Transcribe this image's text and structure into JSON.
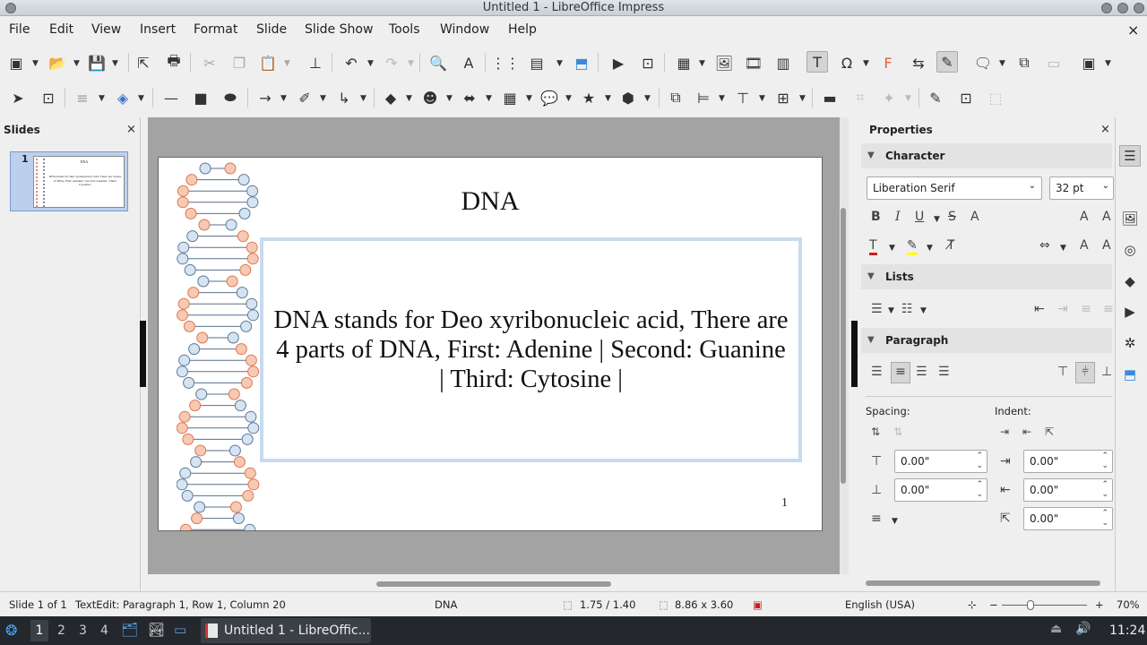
{
  "window": {
    "title": "Untitled 1 - LibreOffice Impress",
    "close_symbol": "×"
  },
  "menu": [
    "File",
    "Edit",
    "View",
    "Insert",
    "Format",
    "Slide",
    "Slide Show",
    "Tools",
    "Window",
    "Help"
  ],
  "slides_panel": {
    "title": "Slides",
    "close": "×",
    "thumb_number": "1"
  },
  "slide": {
    "title": "DNA",
    "body": "DNA stands for Deo xyribonucleic acid, There are 4 parts of DNA, First: Adenine | Second: Guanine | Third: Cytosine |",
    "number": "1",
    "thumb_title": "DNA",
    "thumb_body": "DNA stands for Deo xyribonucleic acid, There are 4 parts of DNA, First: Adenine | Second: Guanine | Third: Cytosine |"
  },
  "properties": {
    "title": "Properties",
    "close": "×",
    "character": {
      "label": "Character",
      "font": "Liberation Serif",
      "size": "32 pt"
    },
    "lists": {
      "label": "Lists"
    },
    "paragraph": {
      "label": "Paragraph",
      "spacing_label": "Spacing:",
      "indent_label": "Indent:",
      "above": "0.00\"",
      "below": "0.00\"",
      "before_text": "0.00\"",
      "after_text": "0.00\"",
      "first_line": "0.00\""
    }
  },
  "statusbar": {
    "slide": "Slide 1 of 1",
    "edit": "TextEdit: Paragraph 1, Row 1, Column 20",
    "layout": "DNA",
    "position": "1.75 / 1.40",
    "size": "8.86 x 3.60",
    "language": "English (USA)",
    "zoom": "70%"
  },
  "taskbar": {
    "workspaces": [
      "1",
      "2",
      "3",
      "4"
    ],
    "window_label": "Untitled 1 - LibreOffic...",
    "clock": "11:24"
  }
}
